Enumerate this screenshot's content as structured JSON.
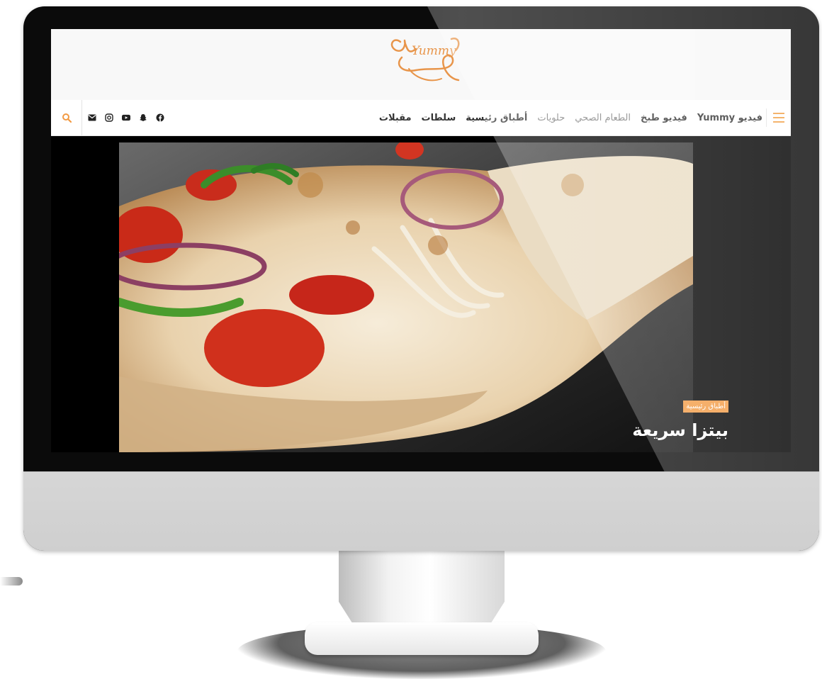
{
  "site": {
    "logo_text": "Yummy"
  },
  "nav": {
    "items": [
      {
        "label": "فيديو Yummy",
        "style": "bold"
      },
      {
        "label": "فيديو طبخ",
        "style": "bold"
      },
      {
        "label": "الطعام الصحي",
        "style": "light"
      },
      {
        "label": "حلويات",
        "style": "light"
      },
      {
        "label": "أطباق رئيسية",
        "style": "bold"
      },
      {
        "label": "سلطات",
        "style": "bold"
      },
      {
        "label": "مقبلات",
        "style": "bold"
      }
    ]
  },
  "icons": {
    "search": "search-icon",
    "social": [
      "envelope-icon",
      "instagram-icon",
      "youtube-icon",
      "snapchat-icon",
      "facebook-icon"
    ]
  },
  "hero": {
    "category": "أطباق رئيسية",
    "title": "بيتزا سريعة"
  },
  "colors": {
    "accent": "#f29a43",
    "logo": "#e8954a"
  }
}
